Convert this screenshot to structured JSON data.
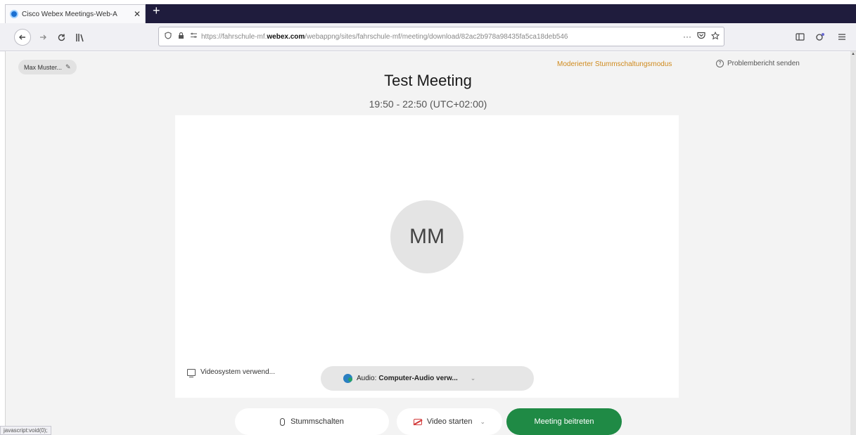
{
  "browser": {
    "tab_title": "Cisco Webex Meetings-Web-A",
    "tab_close": "✕",
    "new_tab": "+",
    "url_prefix": "https://fahrschule-mf.",
    "url_domain": "webex.com",
    "url_suffix": "/webappng/sites/fahrschule-mf/meeting/download/82ac2b978a98435fa5ca18deb546",
    "url_more": "···",
    "status_url": "javascript:void(0);"
  },
  "header": {
    "user_chip": "Max Muster...",
    "moderated_mode": "Moderierter Stummschaltungsmodus",
    "report_problem": "Problembericht senden"
  },
  "meeting": {
    "title": "Test Meeting",
    "time": "19:50 - 22:50 (UTC+02:00)",
    "avatar_initials": "MM"
  },
  "preview": {
    "video_system": "Videosystem verwend...",
    "audio_label": "Audio:",
    "audio_value": "Computer-Audio verw..."
  },
  "actions": {
    "mute": "Stummschalten",
    "video": "Video starten",
    "join": "Meeting beitreten"
  },
  "colors": {
    "tab_strip": "#1f1c3d",
    "join_button": "#1f8a45",
    "moderated_text": "#cf8a1d"
  }
}
